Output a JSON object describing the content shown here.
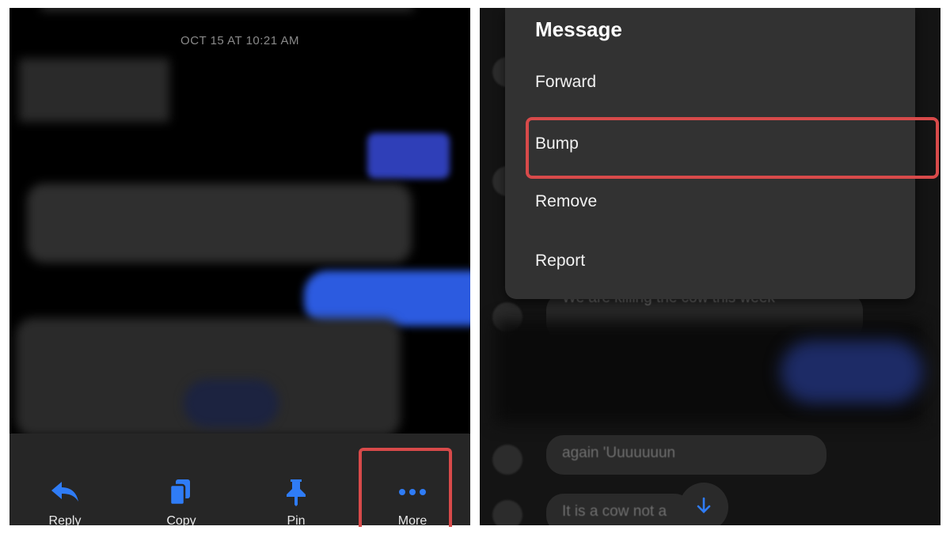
{
  "left_panel": {
    "timestamp": "OCT 15 AT 10:21 AM",
    "actions": [
      {
        "label": "Reply",
        "icon": "reply-icon"
      },
      {
        "label": "Copy",
        "icon": "copy-icon"
      },
      {
        "label": "Pin",
        "icon": "pin-icon"
      },
      {
        "label": "More",
        "icon": "more-dots-icon"
      }
    ]
  },
  "right_panel": {
    "menu": {
      "title": "Message",
      "items": [
        {
          "label": "Forward"
        },
        {
          "label": "Bump"
        },
        {
          "label": "Remove"
        },
        {
          "label": "Report"
        }
      ]
    },
    "background_messages": [
      "We are killing the cow this week",
      "again 'Uuuuuuun",
      "It is a cow not a"
    ]
  },
  "colors": {
    "accent_blue": "#2f7cf6",
    "highlight_red": "#d84a4a",
    "menu_background": "#323232"
  }
}
